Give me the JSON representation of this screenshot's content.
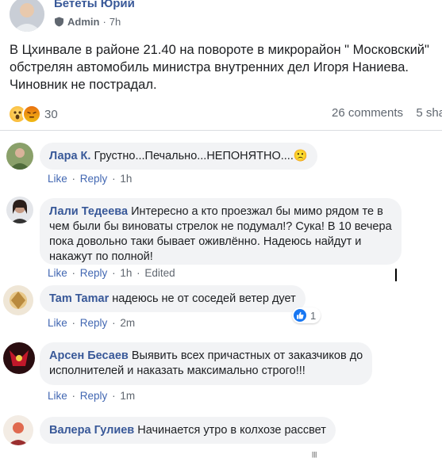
{
  "post": {
    "author": "Бететы Юрий",
    "role": "Admin",
    "separator": "·",
    "time": "7h",
    "lines": [
      "В Цхинвале в районе 21.40 на повороте в микрорайон \" Московский\"",
      "обстрелян автомобиль министра внутренних дел Игоря Наниева.",
      "Чиновник не пострадал."
    ],
    "reactions": {
      "icons": [
        "wow-icon",
        "angry-icon"
      ],
      "count": "30"
    },
    "comments_count": "26 comments",
    "shares_count": "5 sha"
  },
  "comments": [
    {
      "author": "Лара К.",
      "lines": [
        "Грустно...Печально...НЕПОНЯТНО....🙁"
      ],
      "like": "Like",
      "reply": "Reply",
      "sep": "·",
      "time": "1h",
      "edited": ""
    },
    {
      "author": "Лали Тедеева",
      "lines": [
        "Интересно а кто проезжал бы мимо рядом те в",
        "чем были бы виноваты стрелок не подумал!? Сука! В 10 вечера",
        "пока довольно таки бывает оживлённо. Надеюсь найдут и",
        "накажут по полной!"
      ],
      "like": "Like",
      "reply": "Reply",
      "sep": "·",
      "time": "1h",
      "edited": "Edited"
    },
    {
      "author": "Tam Tamar",
      "lines": [
        "надеюсь не от соседей ветер дует"
      ],
      "like": "Like",
      "reply": "Reply",
      "sep": "·",
      "time": "2m",
      "edited": "",
      "reaction_count": "1"
    },
    {
      "author": "Арсен Бесаев",
      "lines": [
        "Выявить всех причастных от заказчиков до",
        "исполнителей и наказать максимально строго!!!"
      ],
      "like": "Like",
      "reply": "Reply",
      "sep": "·",
      "time": "1m",
      "edited": ""
    },
    {
      "author": "Валера Гулиев",
      "lines": [
        "Начинается утро в колхозе рассвет"
      ]
    }
  ],
  "colors": {
    "link": "#385898",
    "bubble": "#f2f3f5",
    "meta": "#606770",
    "like_blue": "#1877f2"
  }
}
